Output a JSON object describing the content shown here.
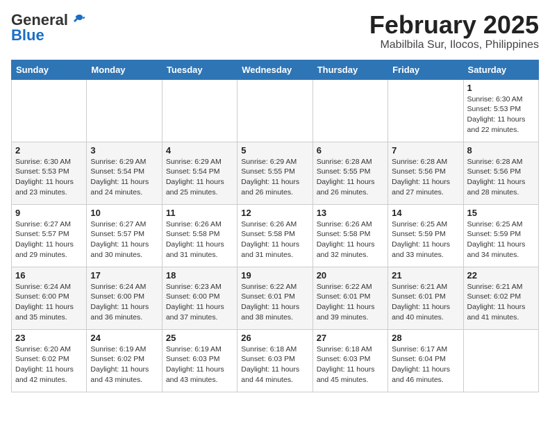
{
  "header": {
    "logo_general": "General",
    "logo_blue": "Blue",
    "title": "February 2025",
    "subtitle": "Mabilbila Sur, Ilocos, Philippines"
  },
  "days_of_week": [
    "Sunday",
    "Monday",
    "Tuesday",
    "Wednesday",
    "Thursday",
    "Friday",
    "Saturday"
  ],
  "weeks": [
    [
      {
        "day": "",
        "info": ""
      },
      {
        "day": "",
        "info": ""
      },
      {
        "day": "",
        "info": ""
      },
      {
        "day": "",
        "info": ""
      },
      {
        "day": "",
        "info": ""
      },
      {
        "day": "",
        "info": ""
      },
      {
        "day": "1",
        "info": "Sunrise: 6:30 AM\nSunset: 5:53 PM\nDaylight: 11 hours\nand 22 minutes."
      }
    ],
    [
      {
        "day": "2",
        "info": "Sunrise: 6:30 AM\nSunset: 5:53 PM\nDaylight: 11 hours\nand 23 minutes."
      },
      {
        "day": "3",
        "info": "Sunrise: 6:29 AM\nSunset: 5:54 PM\nDaylight: 11 hours\nand 24 minutes."
      },
      {
        "day": "4",
        "info": "Sunrise: 6:29 AM\nSunset: 5:54 PM\nDaylight: 11 hours\nand 25 minutes."
      },
      {
        "day": "5",
        "info": "Sunrise: 6:29 AM\nSunset: 5:55 PM\nDaylight: 11 hours\nand 26 minutes."
      },
      {
        "day": "6",
        "info": "Sunrise: 6:28 AM\nSunset: 5:55 PM\nDaylight: 11 hours\nand 26 minutes."
      },
      {
        "day": "7",
        "info": "Sunrise: 6:28 AM\nSunset: 5:56 PM\nDaylight: 11 hours\nand 27 minutes."
      },
      {
        "day": "8",
        "info": "Sunrise: 6:28 AM\nSunset: 5:56 PM\nDaylight: 11 hours\nand 28 minutes."
      }
    ],
    [
      {
        "day": "9",
        "info": "Sunrise: 6:27 AM\nSunset: 5:57 PM\nDaylight: 11 hours\nand 29 minutes."
      },
      {
        "day": "10",
        "info": "Sunrise: 6:27 AM\nSunset: 5:57 PM\nDaylight: 11 hours\nand 30 minutes."
      },
      {
        "day": "11",
        "info": "Sunrise: 6:26 AM\nSunset: 5:58 PM\nDaylight: 11 hours\nand 31 minutes."
      },
      {
        "day": "12",
        "info": "Sunrise: 6:26 AM\nSunset: 5:58 PM\nDaylight: 11 hours\nand 31 minutes."
      },
      {
        "day": "13",
        "info": "Sunrise: 6:26 AM\nSunset: 5:58 PM\nDaylight: 11 hours\nand 32 minutes."
      },
      {
        "day": "14",
        "info": "Sunrise: 6:25 AM\nSunset: 5:59 PM\nDaylight: 11 hours\nand 33 minutes."
      },
      {
        "day": "15",
        "info": "Sunrise: 6:25 AM\nSunset: 5:59 PM\nDaylight: 11 hours\nand 34 minutes."
      }
    ],
    [
      {
        "day": "16",
        "info": "Sunrise: 6:24 AM\nSunset: 6:00 PM\nDaylight: 11 hours\nand 35 minutes."
      },
      {
        "day": "17",
        "info": "Sunrise: 6:24 AM\nSunset: 6:00 PM\nDaylight: 11 hours\nand 36 minutes."
      },
      {
        "day": "18",
        "info": "Sunrise: 6:23 AM\nSunset: 6:00 PM\nDaylight: 11 hours\nand 37 minutes."
      },
      {
        "day": "19",
        "info": "Sunrise: 6:22 AM\nSunset: 6:01 PM\nDaylight: 11 hours\nand 38 minutes."
      },
      {
        "day": "20",
        "info": "Sunrise: 6:22 AM\nSunset: 6:01 PM\nDaylight: 11 hours\nand 39 minutes."
      },
      {
        "day": "21",
        "info": "Sunrise: 6:21 AM\nSunset: 6:01 PM\nDaylight: 11 hours\nand 40 minutes."
      },
      {
        "day": "22",
        "info": "Sunrise: 6:21 AM\nSunset: 6:02 PM\nDaylight: 11 hours\nand 41 minutes."
      }
    ],
    [
      {
        "day": "23",
        "info": "Sunrise: 6:20 AM\nSunset: 6:02 PM\nDaylight: 11 hours\nand 42 minutes."
      },
      {
        "day": "24",
        "info": "Sunrise: 6:19 AM\nSunset: 6:02 PM\nDaylight: 11 hours\nand 43 minutes."
      },
      {
        "day": "25",
        "info": "Sunrise: 6:19 AM\nSunset: 6:03 PM\nDaylight: 11 hours\nand 43 minutes."
      },
      {
        "day": "26",
        "info": "Sunrise: 6:18 AM\nSunset: 6:03 PM\nDaylight: 11 hours\nand 44 minutes."
      },
      {
        "day": "27",
        "info": "Sunrise: 6:18 AM\nSunset: 6:03 PM\nDaylight: 11 hours\nand 45 minutes."
      },
      {
        "day": "28",
        "info": "Sunrise: 6:17 AM\nSunset: 6:04 PM\nDaylight: 11 hours\nand 46 minutes."
      },
      {
        "day": "",
        "info": ""
      }
    ]
  ]
}
